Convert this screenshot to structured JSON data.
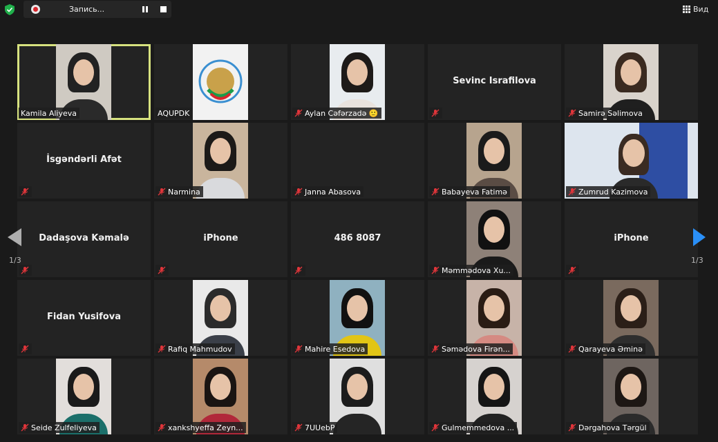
{
  "recording": {
    "label": "Запись..."
  },
  "view": {
    "label": "Вид"
  },
  "pagination": {
    "left": "1/3",
    "right": "1/3"
  },
  "colors": {
    "active_border": "#d7e27f",
    "muted_red": "#e0353a",
    "next_arrow": "#2a8ff7",
    "record_red": "#d8262c"
  },
  "participants": [
    {
      "name": "Kamila Aliyeva",
      "muted": false,
      "video": true,
      "active": true
    },
    {
      "name": "AQUPDK",
      "muted": false,
      "video": true,
      "logo": true
    },
    {
      "name": "Aylan Cəfərzadə 🙂",
      "muted": true,
      "video": true
    },
    {
      "name": "Sevinc Israfilova",
      "muted": true,
      "video": false
    },
    {
      "name": "Samirə Səlimova",
      "muted": true,
      "video": true
    },
    {
      "name": "İsgəndərli Afət",
      "muted": true,
      "video": false
    },
    {
      "name": "Narmina",
      "muted": true,
      "video": true
    },
    {
      "name": "Janna Abasova",
      "muted": true,
      "video": false,
      "show_label_only": true
    },
    {
      "name": "Babayeva Fatimə",
      "muted": true,
      "video": true
    },
    {
      "name": "Zumrud Kazimova",
      "muted": true,
      "video": true,
      "banner": true
    },
    {
      "name": "Dadaşova Kəmalə",
      "muted": true,
      "video": false
    },
    {
      "name": "iPhone",
      "muted": true,
      "video": false
    },
    {
      "name": "486 8087",
      "muted": true,
      "video": false
    },
    {
      "name": "Məmmədova Xu...",
      "muted": true,
      "video": true
    },
    {
      "name": "iPhone",
      "muted": true,
      "video": false
    },
    {
      "name": "Fidan Yusifova",
      "muted": true,
      "video": false
    },
    {
      "name": "Rafiq Mahmudov",
      "muted": true,
      "video": true
    },
    {
      "name": "Mahire Esedova",
      "muted": true,
      "video": true
    },
    {
      "name": "Səmədova Firən...",
      "muted": true,
      "video": true
    },
    {
      "name": "Qarayeva Əminə",
      "muted": true,
      "video": true
    },
    {
      "name": "Seide Zulfeliyeva",
      "muted": true,
      "video": true
    },
    {
      "name": "xankshyeffa Zeyn...",
      "muted": true,
      "video": true
    },
    {
      "name": "7UUebP",
      "muted": true,
      "video": true
    },
    {
      "name": "Gulmemmedova ...",
      "muted": true,
      "video": true
    },
    {
      "name": "Dərgahova Tərgül",
      "muted": true,
      "video": true
    }
  ]
}
